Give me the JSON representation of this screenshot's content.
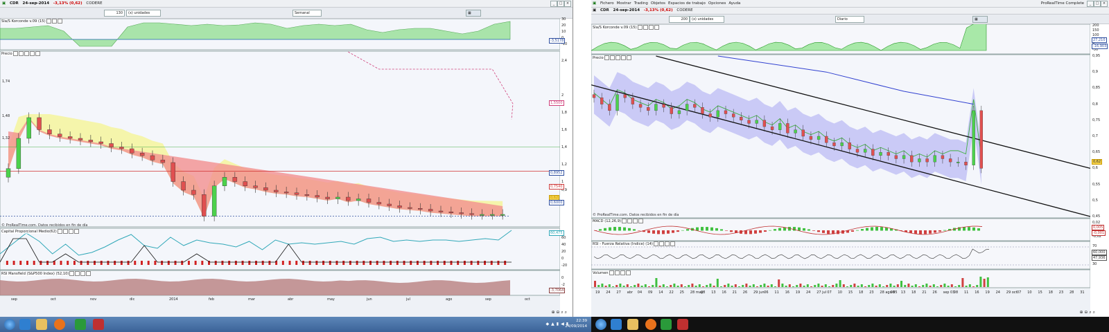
{
  "left_window": {
    "title": {
      "ticker": "CDR",
      "date": "24-sep-2014",
      "change": "-3,13% (0,62)",
      "name": "CODERE"
    },
    "toolbar": {
      "units_value": "130",
      "units_label": "(x) unidades",
      "period": "Semanal"
    },
    "panels": {
      "indicator1": "Sla/S Korconde v.09 (15)",
      "price": "Precio",
      "capital": "Capital Proporcional Medio(62)",
      "rsi_mansfield": "RSI Mansfield (S&P500 Index) (52,10)"
    },
    "credit": "© ProRealTime.com. Datos recibidos en fin de día",
    "price_axis": [
      "2,4",
      "2",
      "1,8",
      "1,6",
      "1,4",
      "1,2",
      "1",
      "0,9"
    ],
    "price_left_labels": [
      "1,74",
      "1,48",
      "1,32"
    ],
    "price_tags": [
      {
        "text": "1,5500",
        "color": "#d0407a"
      },
      {
        "text": "0,8952",
        "color": "#3050a0"
      },
      {
        "text": "0,7540",
        "color": "#d04040"
      },
      {
        "text": "0,62",
        "color": "#c89a00"
      },
      {
        "text": "0,6000",
        "color": "#3050a0"
      }
    ],
    "ind1_axis": [
      "30",
      "20",
      "10",
      "0",
      "-10"
    ],
    "ind1_tag": "-3,5178",
    "cap_axis": [
      "60",
      "40",
      "20",
      "0",
      "-20"
    ],
    "cap_tag": "60,475",
    "rsi_axis": [
      "0",
      "-2"
    ],
    "rsi_tag": "-3,7064",
    "dates": [
      "sep",
      "oct",
      "nov",
      "dic",
      "2014",
      "feb",
      "mar",
      "abr",
      "may",
      "jun",
      "jul",
      "ago",
      "sep",
      "oct"
    ]
  },
  "right_window": {
    "title": {
      "ticker": "CDR",
      "date": "24-sep-2014",
      "change": "-3,13% (0,62)",
      "name": "CODERE"
    },
    "menu": [
      "Fichero",
      "Mostrar",
      "Trading",
      "Objetos",
      "Espacios de trabajo",
      "Opciones",
      "Ayuda"
    ],
    "app_name": "ProRealTime Complete",
    "toolbar": {
      "units_value": "200",
      "units_label": "(x) unidades",
      "period": "Diario"
    },
    "panels": {
      "indicator1": "Sla/S Korconde v.09 (15)",
      "price": "Precio",
      "macd": "MACD (12,26,9)",
      "rsi": "RSI - Fuerza Relativa (Indice) (14)",
      "volume": "Volumen"
    },
    "credit": "© ProRealTime.com. Datos recibidos en fin de día",
    "price_axis": [
      "0,95",
      "0,9",
      "0,85",
      "0,8",
      "0,75",
      "0,7",
      "0,65",
      "0,6",
      "0,55",
      "0,5",
      "0,45"
    ],
    "price_tags": [
      {
        "text": "0,62",
        "color": "#c89a00"
      }
    ],
    "ind1_axis": [
      "200",
      "150",
      "100",
      "50",
      "0",
      "-50"
    ],
    "ind1_tags": [
      "27,210",
      "-16,903"
    ],
    "macd_axis": [
      "0,02",
      "0",
      "-0,02"
    ],
    "macd_tags": [
      "0,005",
      "-0,001"
    ],
    "rsi_axis": [
      "70",
      "30"
    ],
    "rsi_tags": [
      "60,000",
      "47,936"
    ],
    "dates": [
      "19",
      "24",
      "27",
      "abr",
      "04",
      "09",
      "14",
      "22",
      "25",
      "28 may",
      "08",
      "13",
      "16",
      "21",
      "26",
      "29 jun",
      "06",
      "11",
      "16",
      "19",
      "24",
      "27 jul",
      "07",
      "10",
      "15",
      "18",
      "23",
      "28 ago 05",
      "08",
      "13",
      "18",
      "21",
      "26",
      "sep 03",
      "08",
      "11",
      "16",
      "19",
      "24",
      "29 oct",
      "07",
      "10",
      "15",
      "18",
      "23",
      "28",
      "31"
    ]
  },
  "taskbar": {
    "time": "22:39",
    "date": "24/09/2014"
  },
  "chart_data": [
    {
      "type": "candlestick",
      "title": "CDR Semanal",
      "ylim": [
        0.5,
        2.5
      ],
      "close_series": [
        1.15,
        1.5,
        1.74,
        1.6,
        1.55,
        1.52,
        1.5,
        1.48,
        1.46,
        1.44,
        1.4,
        1.38,
        1.33,
        1.3,
        1.25,
        1.22,
        1.0,
        0.9,
        0.85,
        0.6,
        0.95,
        1.05,
        1.0,
        0.95,
        0.93,
        0.9,
        0.88,
        0.87,
        0.85,
        0.84,
        0.82,
        0.8,
        0.82,
        0.78,
        0.8,
        0.76,
        0.74,
        0.72,
        0.7,
        0.69,
        0.68,
        0.66,
        0.65,
        0.64,
        0.63,
        0.62,
        0.62,
        0.62,
        0.62
      ]
    },
    {
      "type": "candlestick",
      "title": "CDR Diario",
      "ylim": [
        0.45,
        0.95
      ],
      "close_series": [
        0.82,
        0.8,
        0.78,
        0.83,
        0.82,
        0.8,
        0.79,
        0.78,
        0.8,
        0.79,
        0.77,
        0.78,
        0.8,
        0.79,
        0.77,
        0.76,
        0.78,
        0.77,
        0.76,
        0.75,
        0.74,
        0.75,
        0.73,
        0.72,
        0.74,
        0.71,
        0.72,
        0.7,
        0.69,
        0.7,
        0.68,
        0.67,
        0.68,
        0.66,
        0.65,
        0.66,
        0.64,
        0.65,
        0.64,
        0.63,
        0.64,
        0.62,
        0.63,
        0.62,
        0.64,
        0.63,
        0.62,
        0.62,
        0.61,
        0.78,
        0.6
      ]
    }
  ]
}
